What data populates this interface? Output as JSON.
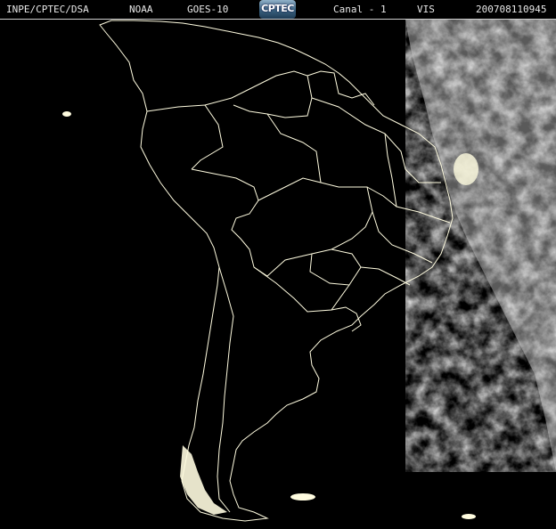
{
  "header": {
    "institution": "INPE/CPTEC/DSA",
    "agency": "NOAA",
    "satellite": "GOES-10",
    "logo_text": "CPTEC",
    "channel": "Canal - 1",
    "band": "VIS",
    "timestamp": "200708110945"
  },
  "colors": {
    "background": "#000000",
    "borders": "#fffce0",
    "clouds": "#e6e6e6",
    "night_side": "#000000",
    "header_text": "#e8e8e8"
  },
  "map": {
    "region": "South America",
    "projection": "geostationary visible imagery"
  }
}
